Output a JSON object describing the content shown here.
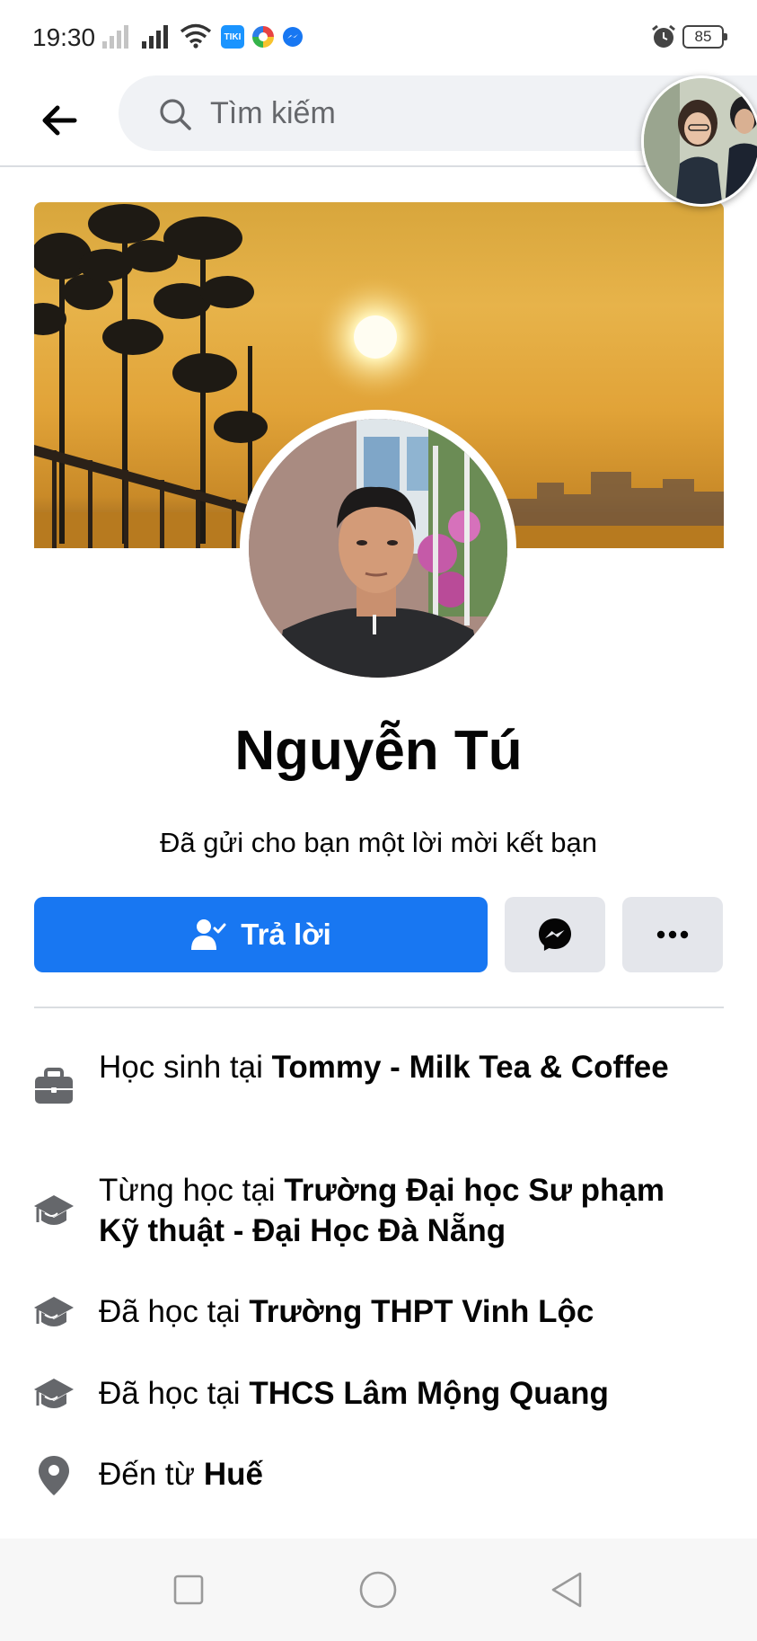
{
  "status_bar": {
    "time": "19:30",
    "tiki_label": "TIKI",
    "battery": "85"
  },
  "header": {
    "search_placeholder": "Tìm kiếm"
  },
  "profile": {
    "name": "Nguyễn Tú",
    "request_text": "Đã gửi cho bạn một lời mời kết bạn",
    "reply_label": "Trả lời"
  },
  "details": [
    {
      "prefix": "Học sinh tại ",
      "value": "Tommy - Milk Tea & Coffee",
      "icon": "briefcase-icon"
    },
    {
      "prefix": "Từng học tại ",
      "value": "Trường Đại học Sư phạm Kỹ thuật - Đại Học Đà Nẵng",
      "icon": "graduation-cap-icon"
    },
    {
      "prefix": "Đã học tại ",
      "value": "Trường THPT Vinh Lộc",
      "icon": "graduation-cap-icon"
    },
    {
      "prefix": "Đã học tại ",
      "value": "THCS Lâm Mộng Quang",
      "icon": "graduation-cap-icon"
    },
    {
      "prefix": "Đến từ ",
      "value": "Huế",
      "icon": "location-pin-icon"
    }
  ],
  "colors": {
    "brand_blue": "#1877f2",
    "button_gray": "#e4e6eb",
    "search_bg": "#f0f2f5"
  }
}
